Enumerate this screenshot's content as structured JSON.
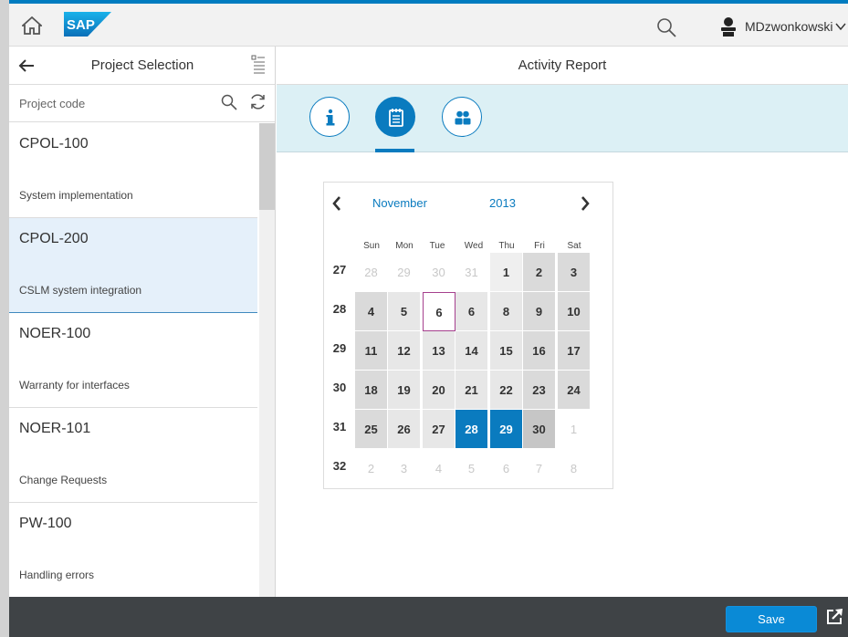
{
  "shell": {
    "user_name": "MDzwonkowski",
    "logo_text": "SAP"
  },
  "master": {
    "title": "Project Selection",
    "search_placeholder": "Project code",
    "items": [
      {
        "code": "CPOL-100",
        "description": "System implementation",
        "selected": false
      },
      {
        "code": "CPOL-200",
        "description": "CSLM system integration",
        "selected": true
      },
      {
        "code": "NOER-100",
        "description": "Warranty for interfaces",
        "selected": false
      },
      {
        "code": "NOER-101",
        "description": "Change Requests",
        "selected": false
      },
      {
        "code": "PW-100",
        "description": "Handling errors",
        "selected": false
      }
    ]
  },
  "detail": {
    "title": "Activity Report",
    "tabs": [
      {
        "icon": "info-icon",
        "active": false
      },
      {
        "icon": "calendar-sheet-icon",
        "active": true
      },
      {
        "icon": "group-icon",
        "active": false
      }
    ]
  },
  "calendar": {
    "month": "November",
    "year": "2013",
    "weekdays": [
      "Sun",
      "Mon",
      "Tue",
      "Wed",
      "Thu",
      "Fri",
      "Sat"
    ],
    "weeks": [
      {
        "num": "27",
        "days": [
          "28",
          "29",
          "30",
          "31",
          "1",
          "2",
          "3"
        ]
      },
      {
        "num": "28",
        "days": [
          "4",
          "5",
          "6",
          "6",
          "8",
          "9",
          "10"
        ]
      },
      {
        "num": "29",
        "days": [
          "11",
          "12",
          "13",
          "14",
          "15",
          "16",
          "17"
        ]
      },
      {
        "num": "30",
        "days": [
          "18",
          "19",
          "20",
          "21",
          "22",
          "23",
          "24"
        ]
      },
      {
        "num": "31",
        "days": [
          "25",
          "26",
          "27",
          "28",
          "29",
          "30",
          "1"
        ]
      },
      {
        "num": "32",
        "days": [
          "2",
          "3",
          "4",
          "5",
          "6",
          "7",
          "8"
        ]
      }
    ],
    "today": "6",
    "selected_days": [
      "28",
      "29"
    ]
  },
  "footer": {
    "save_label": "Save"
  },
  "colors": {
    "accent": "#0a7bbf",
    "shell_border": "#007cc0",
    "tabbar_bg": "#dcf0f5",
    "footer_bg": "#3f4346",
    "today_border": "#a6408e"
  }
}
